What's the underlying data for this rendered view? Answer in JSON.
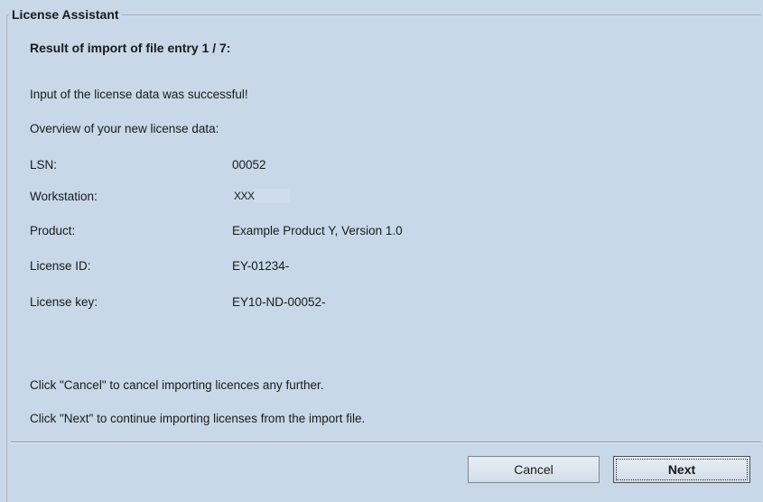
{
  "dialog": {
    "title": "License Assistant",
    "heading": "Result of import of file entry 1 / 7:"
  },
  "messages": {
    "success": "Input of the license data was successful!",
    "overview": "Overview of your new license data:"
  },
  "license": {
    "lsn_label": "LSN:",
    "lsn_value": "00052",
    "workstation_label": "Workstation:",
    "workstation_value": "XXX",
    "product_label": "Product:",
    "product_value": "Example Product Y, Version 1.0",
    "license_id_label": "License ID:",
    "license_id_value": "EY-01234-",
    "license_key_label": "License key:",
    "license_key_value": "EY10-ND-00052-"
  },
  "instructions": {
    "cancel": "Click \"Cancel\" to cancel importing licences any further.",
    "next": "Click \"Next\" to continue importing licenses from the import file."
  },
  "buttons": {
    "cancel_label": "Cancel",
    "next_label": "Next"
  }
}
